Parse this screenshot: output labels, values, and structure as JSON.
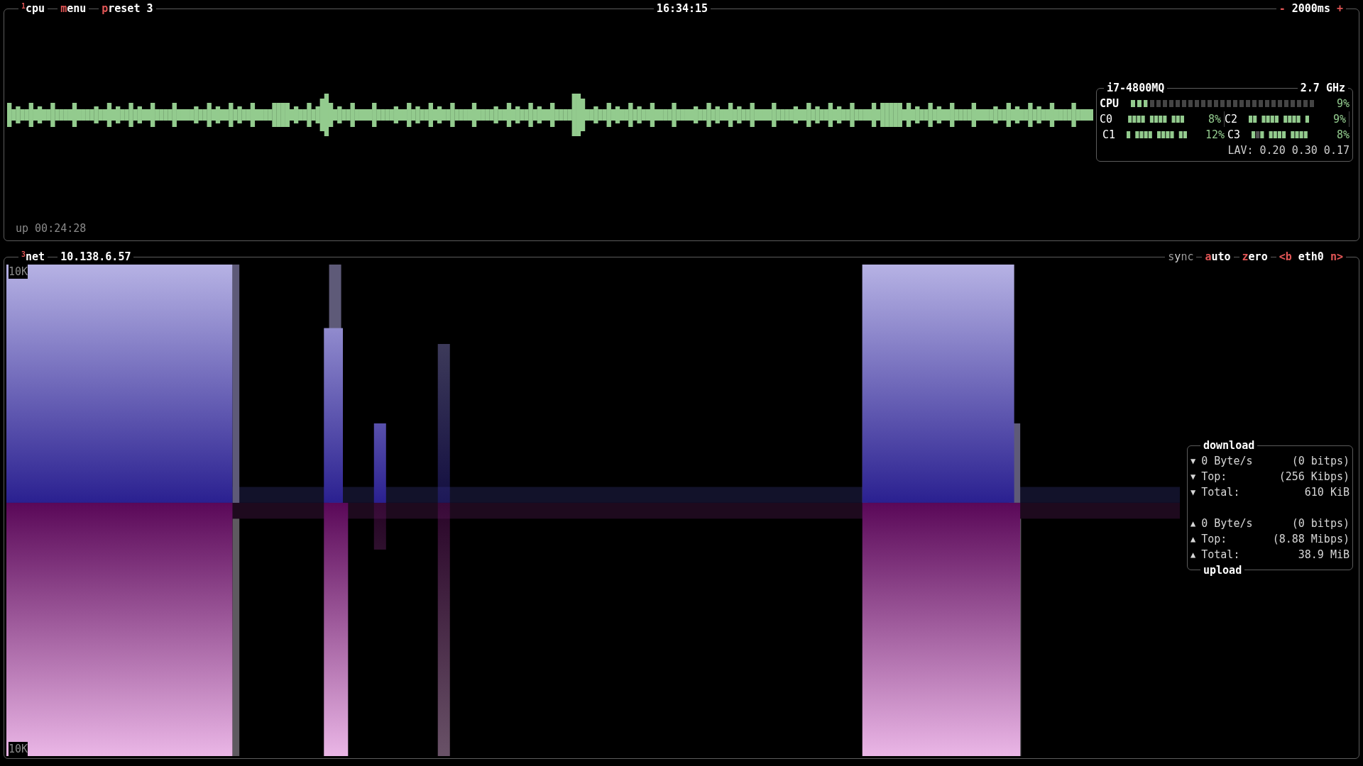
{
  "cpu_box": {
    "number": "1",
    "title": "cpu",
    "menu": {
      "key": "m",
      "after": "enu"
    },
    "preset": {
      "key": "p",
      "after": "reset 3"
    },
    "clock": "16:34:15",
    "interval": {
      "minus": "-",
      "value": "2000ms",
      "plus": "+"
    },
    "uptime": "up 00:24:28",
    "info": {
      "model": "i7-4800MQ",
      "frequency": "2.7 GHz",
      "total": {
        "label": "CPU",
        "level": 0.09,
        "percent": "9%"
      },
      "cores": [
        {
          "label": "C0",
          "percent": "8%"
        },
        {
          "label": "C1",
          "percent": "12%"
        },
        {
          "label": "C2",
          "percent": "9%"
        },
        {
          "label": "C3",
          "percent": "8%"
        }
      ],
      "load_average": "LAV: 0.20 0.30 0.17"
    }
  },
  "net_box": {
    "number": "3",
    "title": "net",
    "address": "10.138.6.57",
    "toggles": [
      {
        "before": "s",
        "key": "y",
        "after": "nc",
        "on": false
      },
      {
        "key": "a",
        "after": "uto",
        "on": true
      },
      {
        "key": "z",
        "after": "ero",
        "on": true
      }
    ],
    "interface": {
      "prev": "<b",
      "name": "eth0",
      "next": "n>"
    },
    "scale_top": "10K",
    "scale_bottom": "10K",
    "download": {
      "title": "download",
      "rows": [
        {
          "arrow": "▼",
          "label": "0 Byte/s",
          "value": "(0 bitps)"
        },
        {
          "arrow": "▼",
          "label": "Top:",
          "value": "(256 Kibps)"
        },
        {
          "arrow": "▼",
          "label": "Total:",
          "value": "610 KiB"
        }
      ]
    },
    "upload": {
      "title": "upload",
      "rows": [
        {
          "arrow": "▲",
          "label": "0 Byte/s",
          "value": "(0 bitps)"
        },
        {
          "arrow": "▲",
          "label": "Top:",
          "value": "(8.88 Mibps)"
        },
        {
          "arrow": "▲",
          "label": "Total:",
          "value": "38.9 MiB"
        }
      ]
    }
  }
}
